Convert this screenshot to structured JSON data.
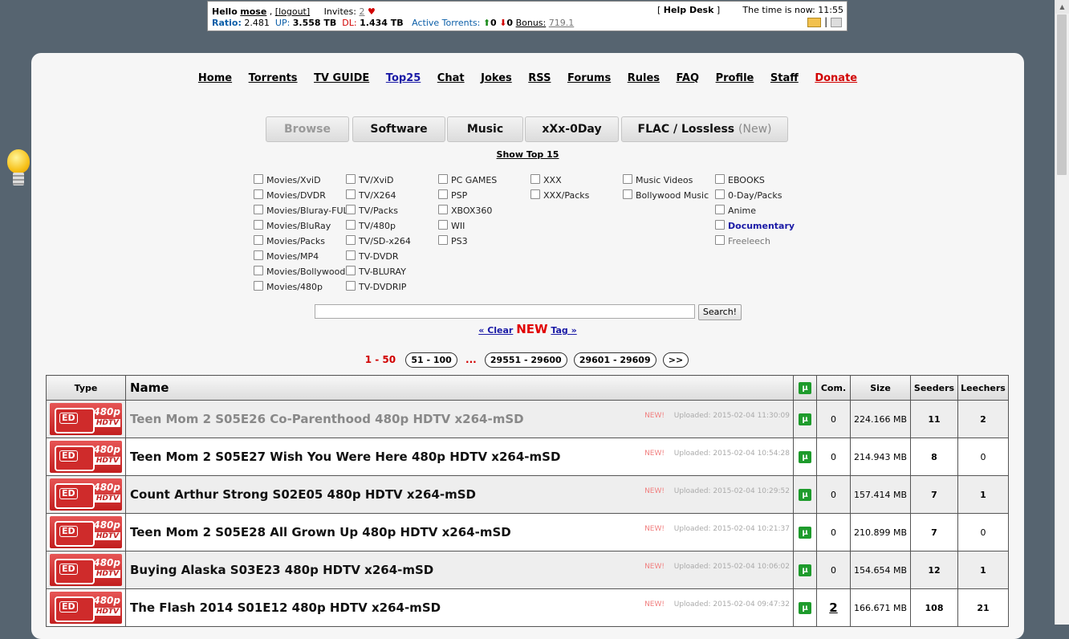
{
  "status": {
    "hello_label": "Hello",
    "username": "mose",
    "logout_label": "[logout]",
    "invites_label": "Invites:",
    "invites_count": "2",
    "ratio_label": "Ratio:",
    "ratio_value": "2.481",
    "up_label": "UP:",
    "up_value": "3.558 TB",
    "dl_label": "DL:",
    "dl_value": "1.434 TB",
    "active_label": "Active Torrents:",
    "active_up": "0",
    "active_down": "0",
    "bonus_label": "Bonus:",
    "bonus_value": "719.1",
    "helpdesk_label": "Help Desk",
    "time_label": "The time is now:",
    "time_value": "11:55"
  },
  "nav": [
    "Home",
    "Torrents",
    "TV GUIDE",
    "Top25",
    "Chat",
    "Jokes",
    "RSS",
    "Forums",
    "Rules",
    "FAQ",
    "Profile",
    "Staff",
    "Donate"
  ],
  "category_buttons": {
    "browse": "Browse",
    "software": "Software",
    "music": "Music",
    "xxx": "xXx-0Day",
    "flac": "FLAC / Lossless",
    "flac_new": "(New)"
  },
  "show_top": "Show Top 15",
  "categories": {
    "col1": [
      "Movies/XviD",
      "Movies/DVDR",
      "Movies/Bluray-FULL",
      "Movies/BluRay",
      "Movies/Packs",
      "Movies/MP4",
      "Movies/Bollywood",
      "Movies/480p"
    ],
    "col2": [
      "TV/XviD",
      "TV/X264",
      "TV/Packs",
      "TV/480p",
      "TV/SD-x264",
      "TV-DVDR",
      "TV-BLURAY",
      "TV-DVDRIP"
    ],
    "col3": [
      "PC GAMES",
      "PSP",
      "XBOX360",
      "WII",
      "PS3"
    ],
    "col4": [
      "XXX",
      "XXX/Packs"
    ],
    "col5": [
      "Music Videos",
      "Bollywood Music"
    ],
    "col6": [
      "EBOOKS",
      "0-Day/Packs",
      "Anime",
      "Documentary",
      "Freeleech"
    ]
  },
  "search": {
    "value": "",
    "button": "Search!"
  },
  "clear_tag": {
    "prefix": "« Clear",
    "new_word": "NEW",
    "suffix": "Tag »"
  },
  "pagination": {
    "current": "1 - 50",
    "pages": [
      "51 - 100",
      "29551 - 29600",
      "29601 - 29609",
      ">>"
    ],
    "dots": "..."
  },
  "table": {
    "headers": {
      "type": "Type",
      "name": "Name",
      "com": "Com.",
      "size": "Size",
      "seeders": "Seeders",
      "leechers": "Leechers"
    },
    "rows": [
      {
        "name": "Teen Mom 2 S05E26 Co-Parenthood 480p HDTV x264-mSD",
        "new": "NEW!",
        "uploaded": "Uploaded: 2015-02-04 11:30:09",
        "com": "0",
        "size": "224.166 MB",
        "seeders": "11",
        "leechers": "2",
        "badge_res": "480p",
        "badge_tv": "HDTV",
        "badge_ed": "ED"
      },
      {
        "name": "Teen Mom 2 S05E27 Wish You Were Here 480p HDTV x264-mSD",
        "new": "NEW!",
        "uploaded": "Uploaded: 2015-02-04 10:54:28",
        "com": "0",
        "size": "214.943 MB",
        "seeders": "8",
        "leechers": "0",
        "badge_res": "480p",
        "badge_tv": "HDTV",
        "badge_ed": "ED"
      },
      {
        "name": "Count Arthur Strong S02E05 480p HDTV x264-mSD",
        "new": "NEW!",
        "uploaded": "Uploaded: 2015-02-04 10:29:52",
        "com": "0",
        "size": "157.414 MB",
        "seeders": "7",
        "leechers": "1",
        "badge_res": "480p",
        "badge_tv": "HDTV",
        "badge_ed": "ED"
      },
      {
        "name": "Teen Mom 2 S05E28 All Grown Up 480p HDTV x264-mSD",
        "new": "NEW!",
        "uploaded": "Uploaded: 2015-02-04 10:21:37",
        "com": "0",
        "size": "210.899 MB",
        "seeders": "7",
        "leechers": "0",
        "badge_res": "480p",
        "badge_tv": "HDTV",
        "badge_ed": "ED"
      },
      {
        "name": "Buying Alaska S03E23 480p HDTV x264-mSD",
        "new": "NEW!",
        "uploaded": "Uploaded: 2015-02-04 10:06:02",
        "com": "0",
        "size": "154.654 MB",
        "seeders": "12",
        "leechers": "1",
        "badge_res": "480p",
        "badge_tv": "HDTV",
        "badge_ed": "ED"
      },
      {
        "name": "The Flash 2014 S01E12 480p HDTV x264-mSD",
        "new": "NEW!",
        "uploaded": "Uploaded: 2015-02-04 09:47:32",
        "com": "2",
        "size": "166.671 MB",
        "seeders": "108",
        "leechers": "21",
        "badge_res": "480p",
        "badge_tv": "HDTV",
        "badge_ed": "ED"
      }
    ]
  }
}
